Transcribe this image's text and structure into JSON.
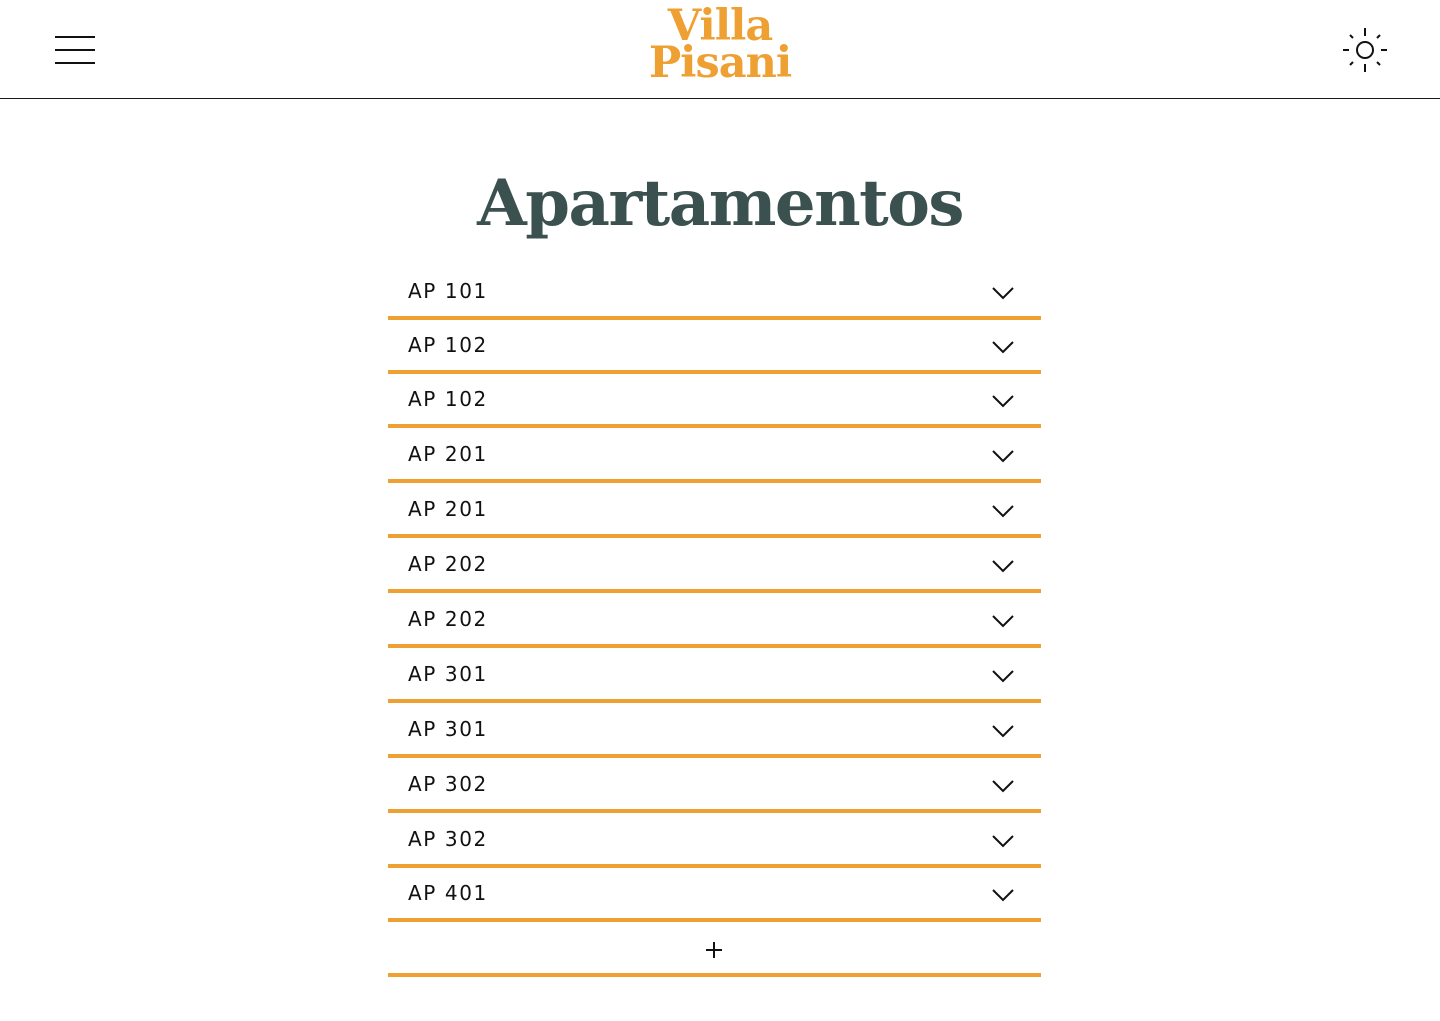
{
  "header": {
    "logo_line1": "Villa",
    "logo_line2": "Pisani",
    "menu_icon": "hamburger-menu-icon",
    "theme_icon": "sun-icon"
  },
  "page": {
    "title": "Apartamentos"
  },
  "apartments": [
    {
      "label": "AP 101"
    },
    {
      "label": "AP 102"
    },
    {
      "label": "AP 102"
    },
    {
      "label": "AP 201"
    },
    {
      "label": "AP 201"
    },
    {
      "label": "AP 202"
    },
    {
      "label": "AP 202"
    },
    {
      "label": "AP 301"
    },
    {
      "label": "AP 301"
    },
    {
      "label": "AP 302"
    },
    {
      "label": "AP 302"
    },
    {
      "label": "AP 401"
    }
  ],
  "add_button": {
    "icon": "plus-icon"
  },
  "colors": {
    "accent": "#EEA032",
    "title": "#3B5150",
    "text": "#111111"
  }
}
